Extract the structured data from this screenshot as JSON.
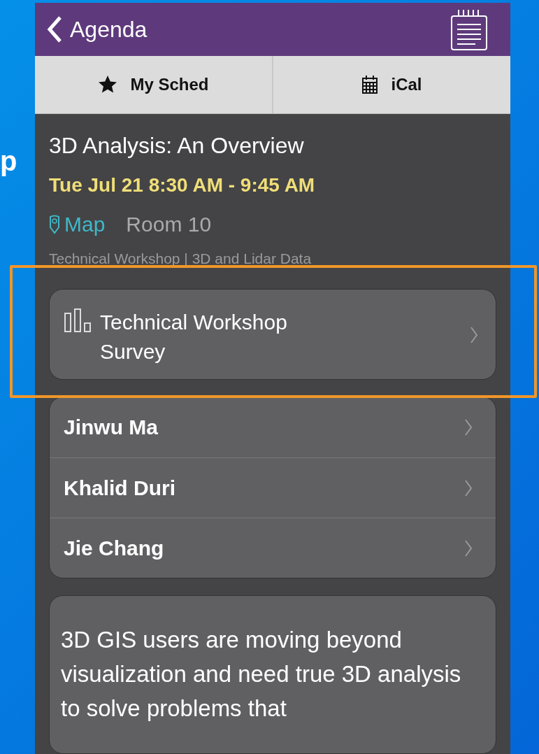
{
  "slide_fragment": "p",
  "header": {
    "back_label": "Agenda"
  },
  "toolbar": [
    {
      "kind": "star",
      "label": "My Sched"
    },
    {
      "kind": "calendar",
      "label": "iCal"
    }
  ],
  "session": {
    "title": "3D Analysis: An Overview",
    "time": "Tue Jul 21 8:30 AM - 9:45 AM",
    "map_link": "Map",
    "room": "Room 10",
    "category": "Technical Workshop | 3D and Lidar Data"
  },
  "survey": {
    "label": "Technical Workshop Survey",
    "highlighted": true
  },
  "speakers": [
    {
      "name": "Jinwu Ma"
    },
    {
      "name": "Khalid Duri"
    },
    {
      "name": "Jie Chang"
    }
  ],
  "description": "3D GIS users are moving beyond visualization and need true 3D analysis to solve problems that"
}
